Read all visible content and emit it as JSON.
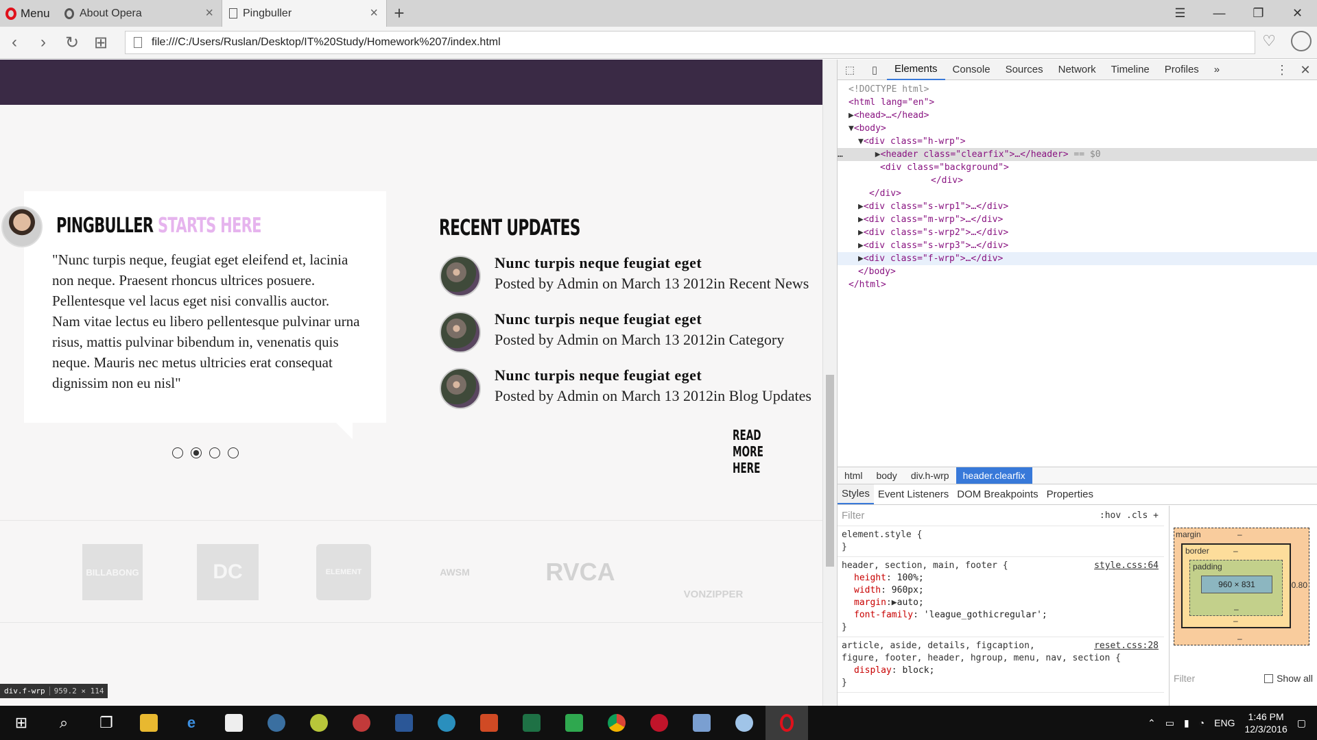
{
  "browser": {
    "menu_label": "Menu",
    "tabs": [
      {
        "label": "About Opera"
      },
      {
        "label": "Pingbuller"
      }
    ],
    "url": "file:///C:/Users/Ruslan/Desktop/IT%20Study/Homework%207/index.html"
  },
  "page": {
    "heading_main": "PINGBULLER",
    "heading_accent": "STARTS HERE",
    "quote": "\"Nunc turpis neque, feugiat eget eleifend et, lacinia non neque. Praesent rhoncus ultrices posuere. Pellentesque vel lacus eget nisi convallis auctor. Nam vitae lectus eu libero pellentesque pulvinar urna risus, mattis pulvinar bibendum in, venenatis quis neque. Mauris nec metus ultricies erat consequat dignissim non eu nisl\"",
    "updates_title": "RECENT UPDATES",
    "updates": [
      {
        "title": "Nunc turpis neque feugiat eget",
        "meta": "Posted by Admin on March 13 2012in Recent News"
      },
      {
        "title": "Nunc turpis neque feugiat eget",
        "meta": "Posted by Admin on March 13 2012in Category"
      },
      {
        "title": "Nunc turpis neque feugiat eget",
        "meta": "Posted by Admin on March 13 2012in Blog Updates"
      }
    ],
    "read_more": "READ MORE HERE",
    "slider_dots": 4,
    "slider_active_dot": 2,
    "brands": [
      "BILLABONG",
      "DC",
      "ELEMENT",
      "AWSM",
      "RVCA",
      "VONZIPPER"
    ],
    "hover_badge_selector": "div.f-wrp",
    "hover_badge_dims": "959.2 × 114"
  },
  "devtools": {
    "tabs": [
      "Elements",
      "Console",
      "Sources",
      "Network",
      "Timeline",
      "Profiles"
    ],
    "active_tab": "Elements",
    "breadcrumbs": [
      "html",
      "body",
      "div.h-wrp",
      "header.clearfix"
    ],
    "style_tabs": [
      "Styles",
      "Event Listeners",
      "DOM Breakpoints",
      "Properties"
    ],
    "filter_placeholder": "Filter",
    "hov_cls": ":hov  .cls",
    "box_margin_label": "margin",
    "box_border_label": "border",
    "box_padding_label": "padding",
    "box_content": "960 × 831",
    "box_right_value": "-0.80",
    "box_dash": "–",
    "show_all": "Show all",
    "ellipsis": "…",
    "dom": {
      "doctype": "<!DOCTYPE html>",
      "html_open": "<html lang=\"en\">",
      "head": "<head>…</head>",
      "body_open": "<body>",
      "div_hwrp": "<div class=\"h-wrp\">",
      "header_line": "<header class=\"clearfix\">…</header>",
      "header_suffix": "== $0",
      "bg_div": "<div class=\"background\">",
      "bg_close": "</div>",
      "div_close": "</div>",
      "s_wrp1": "<div class=\"s-wrp1\">…</div>",
      "m_wrp": "<div class=\"m-wrp\">…</div>",
      "s_wrp2": "<div class=\"s-wrp2\">…</div>",
      "s_wrp3": "<div class=\"s-wrp3\">…</div>",
      "f_wrp": "<div class=\"f-wrp\">…</div>",
      "body_close": "</body>",
      "html_close": "</html>"
    },
    "rules": {
      "element_style": "element.style {",
      "close_brace": "}",
      "r1_selector": "header, section, main, footer {",
      "r1_source": "style.css:64",
      "r1_props": [
        {
          "name": "height",
          "value": "100%;"
        },
        {
          "name": "width",
          "value": "960px;"
        },
        {
          "name": "margin",
          "value": "auto;"
        },
        {
          "name": "font-family",
          "value": "'league_gothicregular';"
        }
      ],
      "r2_selector_1": "article, aside, details, figcaption,",
      "r2_selector_2": "figure, footer, header, hgroup, menu, nav, section {",
      "r2_source": "reset.css:28",
      "r2_prop": {
        "name": "display",
        "value": "block;"
      }
    }
  },
  "taskbar": {
    "lang": "ENG",
    "time": "1:46 PM",
    "date": "12/3/2016"
  },
  "colors": {
    "accent": "#e6b4ee",
    "page_band": "#3a2a45",
    "devtools_active": "#3879d9",
    "opera_red": "#e0111b"
  }
}
